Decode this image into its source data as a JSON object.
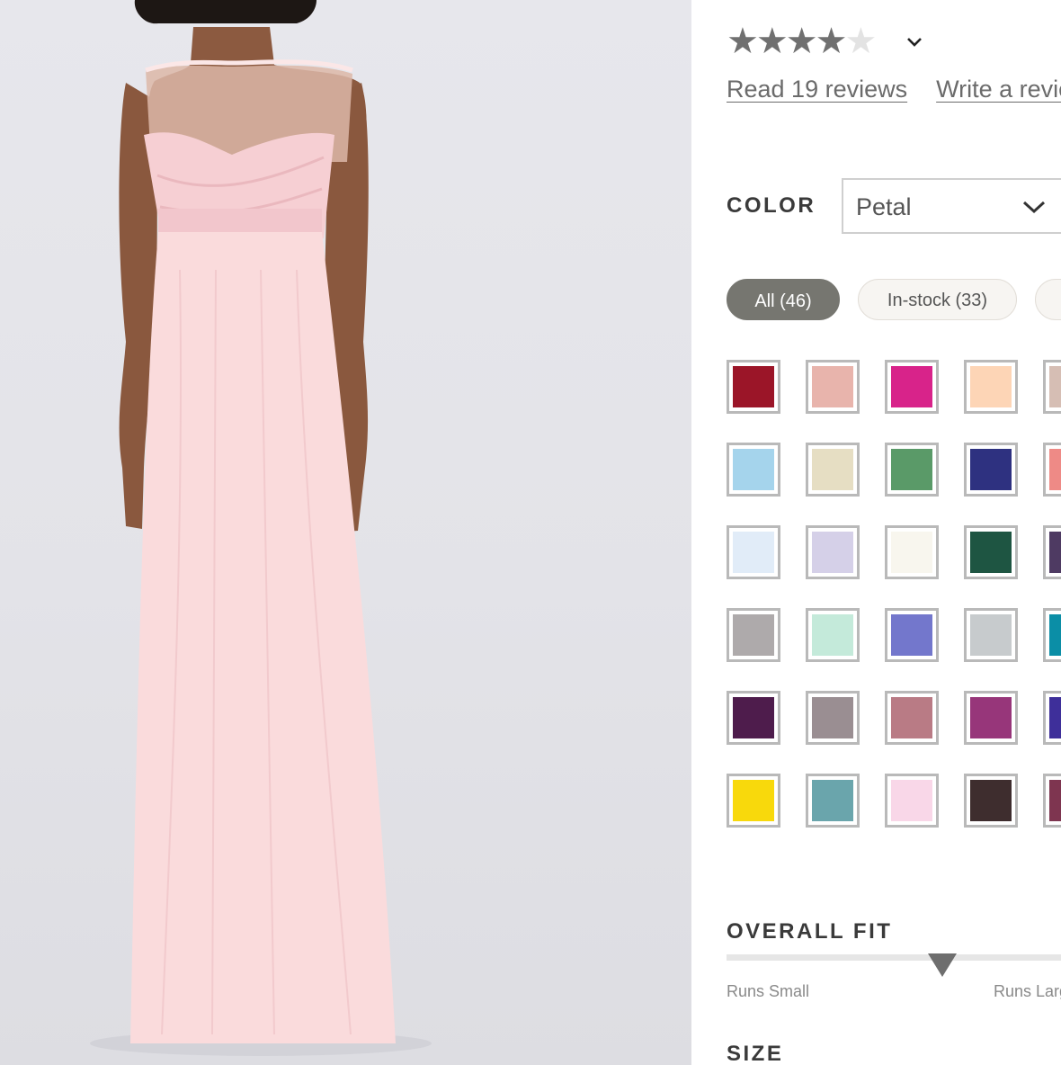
{
  "product": {
    "image_alt": "Model wearing long blush chiffon dress with illusion neckline",
    "dress_color": "#fadbdc"
  },
  "rating": {
    "stars_filled": 4,
    "stars_total": 5,
    "read_reviews": "Read 19 reviews",
    "write_review": "Write a review"
  },
  "color": {
    "label": "COLOR",
    "selected": "Petal",
    "chevron_icon": "chevron-down-icon"
  },
  "filters": [
    {
      "label": "All (46)",
      "active": true
    },
    {
      "label": "In-stock (33)",
      "active": false
    },
    {
      "label": "",
      "active": false
    }
  ],
  "swatches": [
    [
      "#9b1528",
      "#e8b4ac",
      "#d8238a",
      "#fdd5b6",
      "#d6beb4"
    ],
    [
      "#a5d4ec",
      "#e6dec3",
      "#5a9a68",
      "#2e3180",
      "#ee8a86"
    ],
    [
      "#e1ecf8",
      "#d5d0e8",
      "#f8f6ee",
      "#1e5542",
      "#4e3a62"
    ],
    [
      "#aeaaab",
      "#c4eada",
      "#7377cc",
      "#c7cbcd",
      "#0b8ea6"
    ],
    [
      "#4e1c4c",
      "#9a8e92",
      "#b97b85",
      "#97367a",
      "#3e2f9a"
    ],
    [
      "#f8d90c",
      "#6aa5ac",
      "#f9d7e8",
      "#3e2d2e",
      "#7e3550"
    ]
  ],
  "fit": {
    "label": "OVERALL FIT",
    "min_label": "Runs Small",
    "max_label": "Runs Large",
    "position_fraction": 0.6
  },
  "size": {
    "label": "SIZE"
  }
}
